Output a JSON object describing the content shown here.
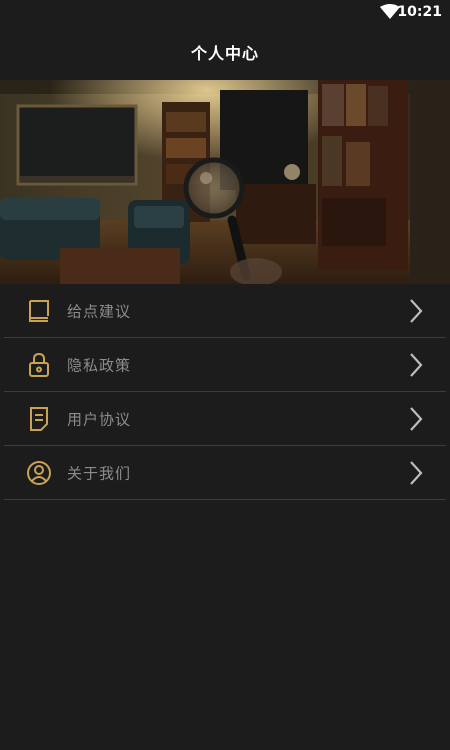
{
  "status_bar": {
    "time": "10:21",
    "wifi_icon": "wifi-icon"
  },
  "header": {
    "title": "个人中心"
  },
  "banner": {
    "image": "detective-study-room-with-magnifying-glass"
  },
  "menu": {
    "items": [
      {
        "label": "给点建议",
        "icon": "feedback-icon"
      },
      {
        "label": "隐私政策",
        "icon": "lock-icon"
      },
      {
        "label": "用户协议",
        "icon": "document-icon"
      },
      {
        "label": "关于我们",
        "icon": "user-circle-icon"
      }
    ]
  },
  "colors": {
    "background": "#1c1c1c",
    "accent_gold": "#c9a253",
    "label_gray": "#8c8c8c",
    "divider": "#3c3c3c"
  }
}
